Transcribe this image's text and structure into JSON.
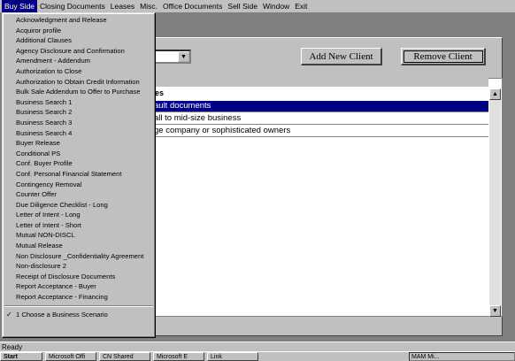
{
  "menubar": {
    "items": [
      "Buy Side",
      "Closing Documents",
      "Leases",
      "Misc.",
      "Office Documents",
      "Sell Side",
      "Window",
      "Exit"
    ]
  },
  "toolbar": {
    "add_label": "Add New Client",
    "remove_label": "Remove Client",
    "combo_arrow": "▼"
  },
  "list": {
    "header_label": "es",
    "rows": [
      "ault documents",
      "all to mid-size business",
      "ge company or sophisticated owners"
    ],
    "selected_index": 0
  },
  "dropdown": {
    "items": [
      "Acknowledgment and Release",
      "Acquiror profile",
      "Additional Clauses",
      "Agency Disclosure and Confirmation",
      "Amendment - Addendum",
      "Authorization to Close",
      "Authorization to Obtain Credit Information",
      "Bulk Sale Addendum to Offer to Purchase",
      "Business Search 1",
      "Business Search 2",
      "Business Search 3",
      "Business Search 4",
      "Buyer Release",
      "Conditional PS",
      "Conf. Buyer Profile",
      "Conf. Personal Financial Statement",
      "Contingency Removal",
      "Counter Offer",
      "Due Diligence Checklist - Long",
      "Letter of Intent - Long",
      "Letter of Intent - Short",
      "Mutual NON-DISCL",
      "Mutual Release",
      "Non Disclosure _Confidentiality Agreement",
      "Non-disclosure 2",
      "Receipt of Disclosure Documents",
      "Report Acceptance - Buyer",
      "Report Acceptance - Financing"
    ],
    "checked_item": "1 Choose a Business Scenario",
    "check_mark": "✓"
  },
  "status": {
    "text": "Ready"
  },
  "taskbar": {
    "start_label": "Start",
    "windows": [
      "Microsoft Offi",
      "CN Shared",
      "Microsoft E",
      "Link"
    ],
    "tray_text": "MAM Mi..."
  },
  "scroll": {
    "up": "▲",
    "down": "▼"
  }
}
